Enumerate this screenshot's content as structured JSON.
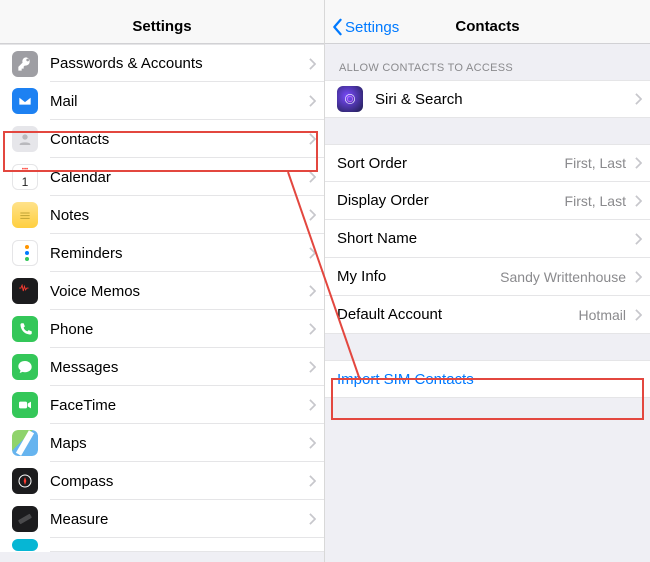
{
  "left": {
    "title": "Settings",
    "items": [
      {
        "label": "Passwords & Accounts"
      },
      {
        "label": "Mail"
      },
      {
        "label": "Contacts"
      },
      {
        "label": "Calendar"
      },
      {
        "label": "Notes"
      },
      {
        "label": "Reminders"
      },
      {
        "label": "Voice Memos"
      },
      {
        "label": "Phone"
      },
      {
        "label": "Messages"
      },
      {
        "label": "FaceTime"
      },
      {
        "label": "Maps"
      },
      {
        "label": "Compass"
      },
      {
        "label": "Measure"
      }
    ]
  },
  "right": {
    "back": "Settings",
    "title": "Contacts",
    "sectionHeader": "ALLOW CONTACTS TO ACCESS",
    "siri": {
      "label": "Siri & Search"
    },
    "rows": [
      {
        "label": "Sort Order",
        "value": "First, Last"
      },
      {
        "label": "Display Order",
        "value": "First, Last"
      },
      {
        "label": "Short Name",
        "value": ""
      },
      {
        "label": "My Info",
        "value": "Sandy Writtenhouse"
      },
      {
        "label": "Default Account",
        "value": "Hotmail"
      }
    ],
    "import": {
      "label": "Import SIM Contacts"
    }
  }
}
